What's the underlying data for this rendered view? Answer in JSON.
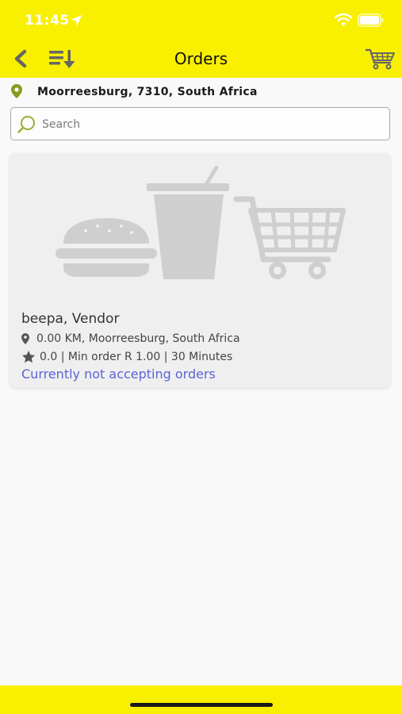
{
  "status_bar": {
    "time": "11:45"
  },
  "nav": {
    "title": "Orders",
    "icons": {
      "back": "chevron-left-icon",
      "sort": "sort-descending-icon",
      "cart": "shopping-cart-icon"
    }
  },
  "location": {
    "text": "Moorreesburg, 7310, South Africa",
    "pin_color": "#8a9a1e"
  },
  "search": {
    "placeholder": "Search",
    "value": "",
    "icon_color": "#9bb030"
  },
  "vendor": {
    "name": "beepa, Vendor",
    "address": "0.00 KM, Moorreesburg, South Africa",
    "stats": "0.0 | Min order R 1.00 | 30 Minutes",
    "status": "Currently not accepting orders",
    "status_color": "#5b63d6"
  },
  "colors": {
    "brand_yellow": "#f8f000"
  }
}
